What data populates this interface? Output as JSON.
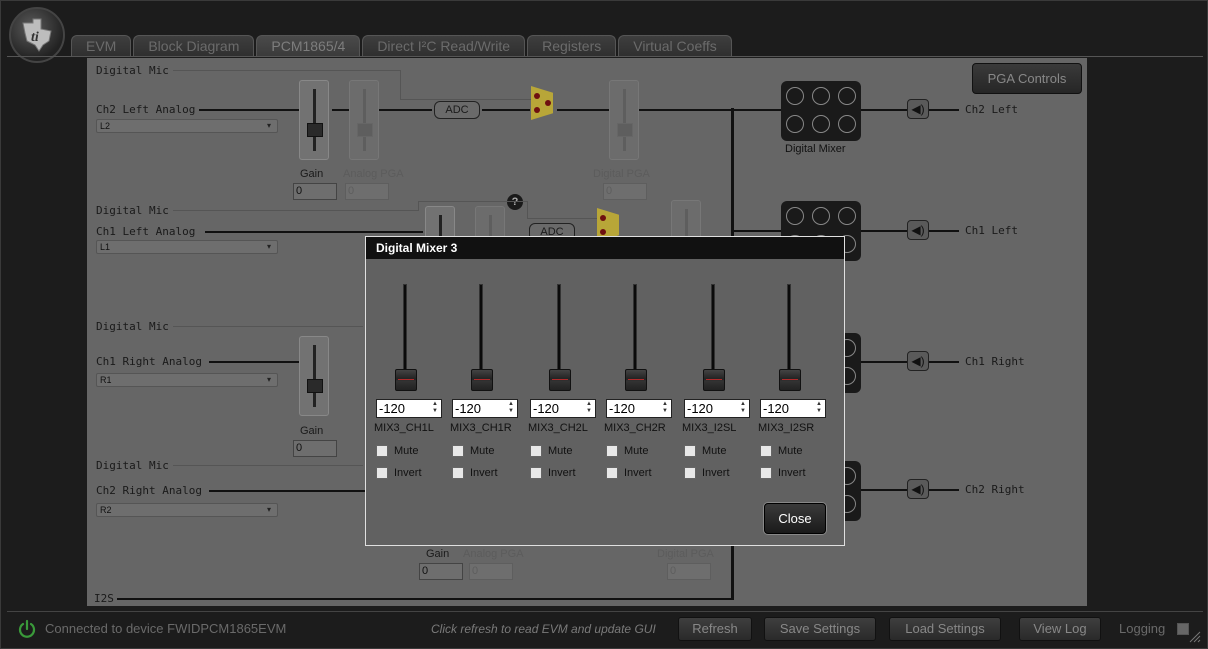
{
  "tabs": [
    {
      "label": "EVM"
    },
    {
      "label": "Block Diagram"
    },
    {
      "label": "PCM1865/4"
    },
    {
      "label": "Direct I²C Read/Write"
    },
    {
      "label": "Registers"
    },
    {
      "label": "Virtual Coeffs"
    }
  ],
  "active_tab": "PCM1865/4",
  "diagram": {
    "rows": [
      {
        "mic": "Digital Mic",
        "analog": "Ch2 Left Analog",
        "select": "L2",
        "output": "Ch2 Left"
      },
      {
        "mic": "Digital Mic",
        "analog": "Ch1 Left Analog",
        "select": "L1",
        "output": "Ch1 Left"
      },
      {
        "mic": "Digital Mic",
        "analog": "Ch1 Right Analog",
        "select": "R1",
        "output": "Ch1 Right"
      },
      {
        "mic": "Digital Mic",
        "analog": "Ch2 Right Analog",
        "select": "R2",
        "output": "Ch2 Right"
      }
    ],
    "gain_label": "Gain",
    "analog_pga_label": "Analog PGA",
    "digital_pga_label": "Digital PGA",
    "adc_label": "ADC",
    "digital_mixer_label": "Digital Mixer",
    "zero": "0",
    "help": "?",
    "i2s_label": "I2S",
    "pga_controls": "PGA Controls"
  },
  "dialog": {
    "title": "Digital Mixer 3",
    "channels": [
      {
        "name": "MIX3_CH1L",
        "value": "-120",
        "mute": "Mute",
        "invert": "Invert"
      },
      {
        "name": "MIX3_CH1R",
        "value": "-120",
        "mute": "Mute",
        "invert": "Invert"
      },
      {
        "name": "MIX3_CH2L",
        "value": "-120",
        "mute": "Mute",
        "invert": "Invert"
      },
      {
        "name": "MIX3_CH2R",
        "value": "-120",
        "mute": "Mute",
        "invert": "Invert"
      },
      {
        "name": "MIX3_I2SL",
        "value": "-120",
        "mute": "Mute",
        "invert": "Invert"
      },
      {
        "name": "MIX3_I2SR",
        "value": "-120",
        "mute": "Mute",
        "invert": "Invert"
      }
    ],
    "close": "Close"
  },
  "footer": {
    "status": "Connected to device FWIDPCM1865EVM",
    "hint": "Click refresh to read EVM and update GUI",
    "refresh": "Refresh",
    "save_settings": "Save Settings",
    "load_settings": "Load Settings",
    "view_log": "View Log",
    "logging": "Logging"
  },
  "colors": {
    "power": "#3a9a3a",
    "mux": "#b8a638",
    "dialog_bg": "#616161"
  }
}
